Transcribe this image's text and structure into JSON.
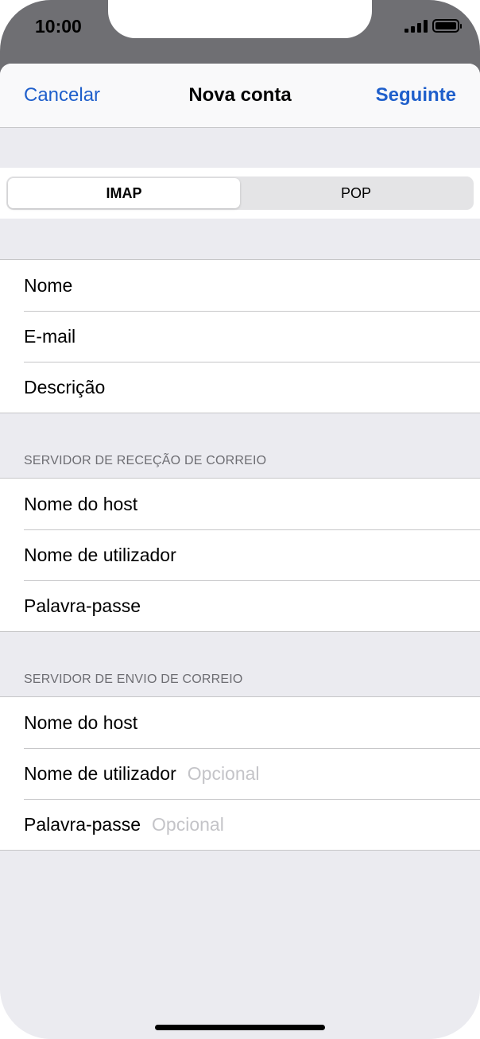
{
  "status_bar": {
    "time": "10:00"
  },
  "navbar": {
    "cancel": "Cancelar",
    "title": "Nova conta",
    "next": "Seguinte"
  },
  "segmented": {
    "options": [
      "IMAP",
      "POP"
    ],
    "selected": "IMAP"
  },
  "account_fields": [
    "Nome",
    "E-mail",
    "Descrição"
  ],
  "incoming": {
    "header": "SERVIDOR DE RECEÇÃO DE CORREIO",
    "fields": [
      "Nome do host",
      "Nome de utilizador",
      "Palavra-passe"
    ]
  },
  "outgoing": {
    "header": "SERVIDOR DE ENVIO DE CORREIO",
    "fields": [
      {
        "label": "Nome do host",
        "placeholder": ""
      },
      {
        "label": "Nome de utilizador",
        "placeholder": "Opcional"
      },
      {
        "label": "Palavra-passe",
        "placeholder": "Opcional"
      }
    ]
  },
  "colors": {
    "accent": "#1f5fcb",
    "grouped_bg": "#ebebf0",
    "separator": "#c6c6c8",
    "placeholder": "#c4c4c8"
  }
}
